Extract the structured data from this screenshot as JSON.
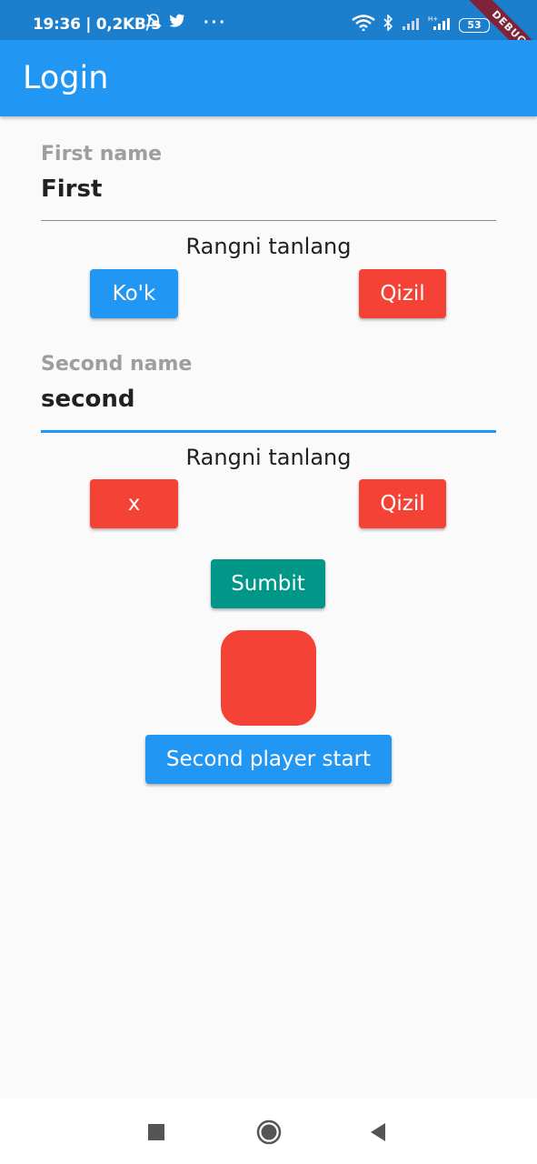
{
  "status_bar": {
    "time_info": "19:36 | 0,2KB/s",
    "battery": "53",
    "debug_banner": "DEBUG",
    "icons": [
      "notification-off-icon",
      "twitter-icon",
      "more-icon",
      "wifi-icon",
      "bluetooth-icon",
      "signal-icon",
      "signal-hplus-icon",
      "battery-icon"
    ]
  },
  "app_bar": {
    "title": "Login"
  },
  "first_player": {
    "label": "First name",
    "value": "First",
    "choose_color": "Rangni tanlang",
    "buttons": [
      {
        "label": "Ko'k",
        "color": "#2196f3"
      },
      {
        "label": "Qizil",
        "color": "#f44336"
      }
    ]
  },
  "second_player": {
    "label": "Second name",
    "value": "second",
    "choose_color": "Rangni tanlang",
    "buttons": [
      {
        "label": "x",
        "color": "#f44336"
      },
      {
        "label": "Qizil",
        "color": "#f44336"
      }
    ]
  },
  "submit_button": {
    "label": "Sumbit",
    "color": "#009688"
  },
  "color_preview": {
    "color": "#f44336"
  },
  "start_button": {
    "label": "Second player start",
    "color": "#2196f3"
  },
  "nav_bar": {
    "icons": [
      "recent-apps-icon",
      "home-icon",
      "back-icon"
    ]
  },
  "colors": {
    "primary": "#2196f3",
    "status_bar": "#1c7fcd",
    "focused_underline": "#2196f3",
    "background": "#fafafa"
  }
}
